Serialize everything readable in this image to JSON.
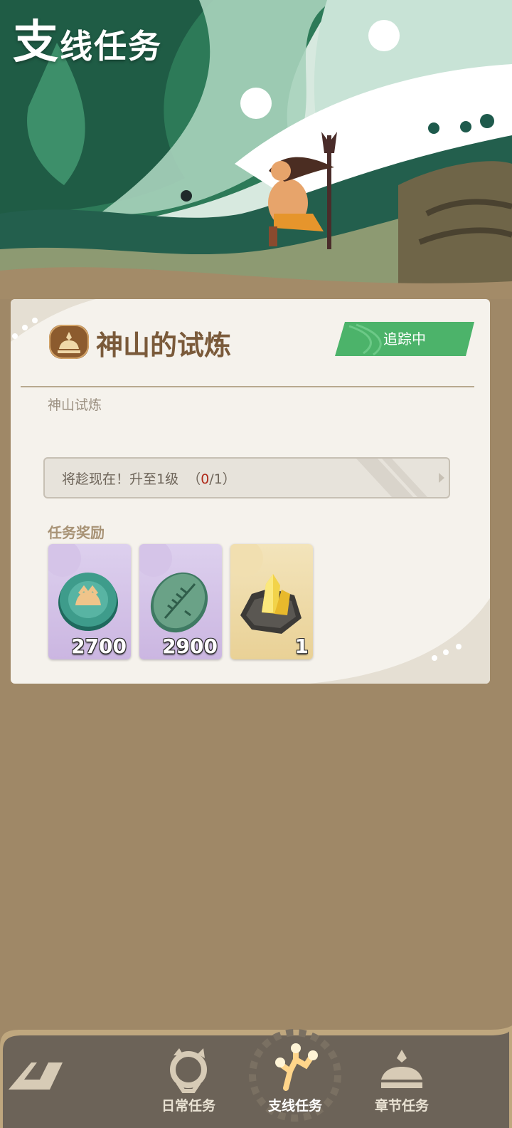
{
  "header": {
    "title_big": "支",
    "title_rest": "线任务"
  },
  "quest": {
    "title": "神山的试炼",
    "status_button": "追踪中",
    "subtitle": "神山试炼",
    "objective": {
      "text": "将趁现在！升至1级",
      "current": "0",
      "total": "/1",
      "open": "（",
      "close": "）"
    }
  },
  "rewards": {
    "label": "任务奖励",
    "items": [
      {
        "icon": "jade-coin-icon",
        "quantity": "2700"
      },
      {
        "icon": "green-stone-tablet-icon",
        "quantity": "2900"
      },
      {
        "icon": "yellow-crystal-ore-icon",
        "quantity": "1"
      }
    ]
  },
  "nav": {
    "items": [
      {
        "label": "",
        "icon": "back-logo-icon"
      },
      {
        "label": "日常任务",
        "icon": "daily-quest-icon"
      },
      {
        "label": "支线任务",
        "icon": "side-quest-icon",
        "active": true
      },
      {
        "label": "章节任务",
        "icon": "chapter-quest-icon"
      }
    ]
  },
  "colors": {
    "accent_green": "#4cb36a",
    "card_bg": "#f5f2ec",
    "page_bg": "#9f8867"
  }
}
